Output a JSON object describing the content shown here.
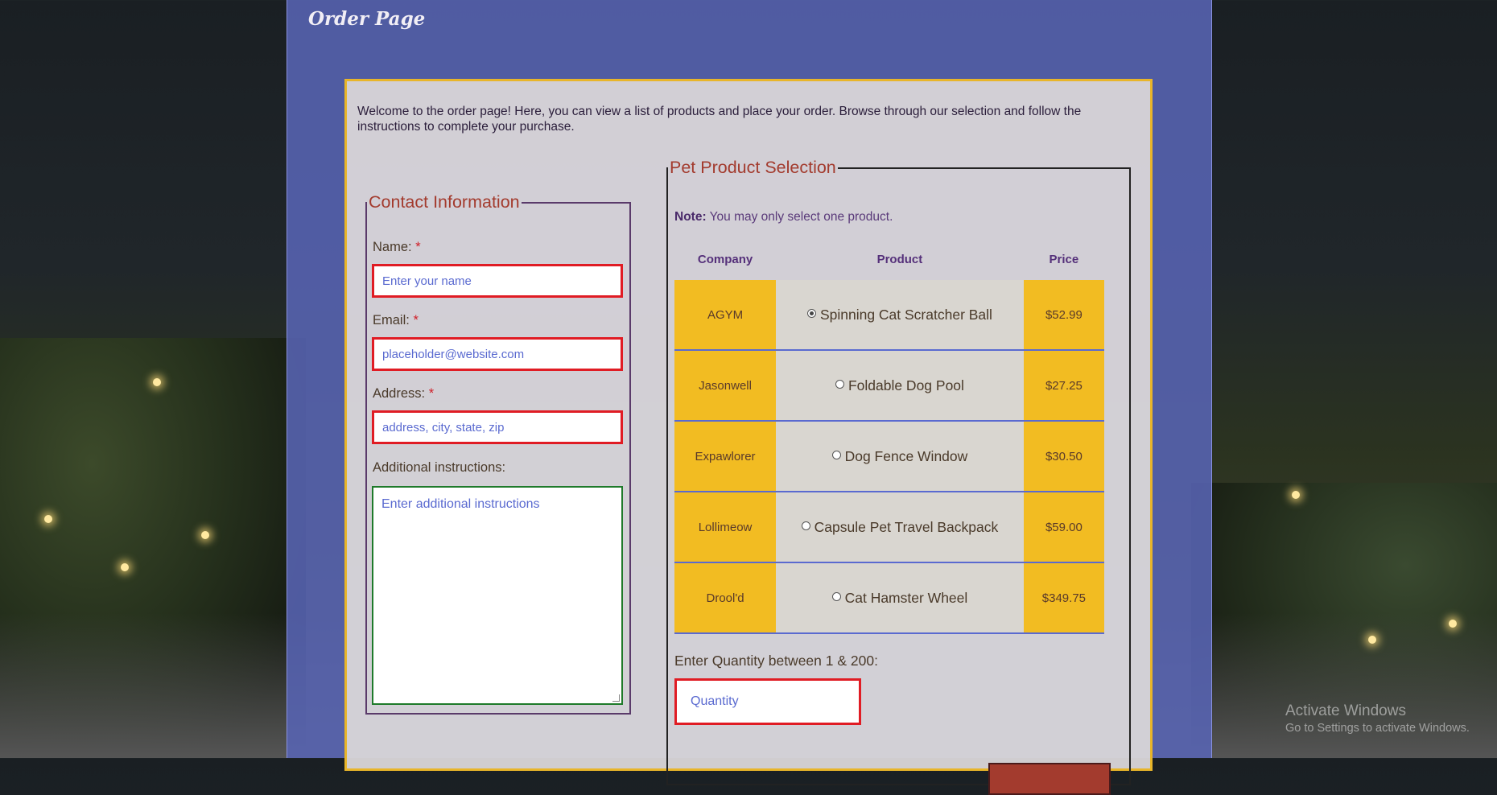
{
  "page": {
    "title": "Order Page"
  },
  "intro": "Welcome to the order page! Here, you can view a list of products and place your order. Browse through our selection and follow the instructions to complete your purchase.",
  "contact": {
    "legend": "Contact Information",
    "name_label": "Name:",
    "name_placeholder": "Enter your name",
    "email_label": "Email:",
    "email_placeholder": "placeholder@website.com",
    "address_label": "Address:",
    "address_placeholder": "address, city, state, zip",
    "instructions_label": "Additional instructions:",
    "instructions_placeholder": "Enter additional instructions",
    "required_marker": "*"
  },
  "products": {
    "legend": "Pet Product Selection",
    "note_bold": "Note:",
    "note_text": " You may only select one product.",
    "headers": [
      "Company",
      "Product",
      "Price"
    ],
    "rows": [
      {
        "company": "AGYM",
        "product": "Spinning Cat Scratcher Ball",
        "price": "$52.99",
        "selected": true
      },
      {
        "company": "Jasonwell",
        "product": "Foldable Dog Pool",
        "price": "$27.25",
        "selected": false
      },
      {
        "company": "Expawlorer",
        "product": "Dog Fence Window",
        "price": "$30.50",
        "selected": false
      },
      {
        "company": "Lollimeow",
        "product": "Capsule Pet Travel Backpack",
        "price": "$59.00",
        "selected": false
      },
      {
        "company": "Drool'd",
        "product": "Cat Hamster Wheel",
        "price": "$349.75",
        "selected": false
      }
    ],
    "quantity_label": "Enter Quantity between 1 & 200:",
    "quantity_placeholder": "Quantity"
  },
  "watermark": {
    "title": "Activate Windows",
    "subtitle": "Go to Settings to activate Windows."
  },
  "colors": {
    "panel": "#5864b4",
    "accent_gold": "#f2bc22",
    "legend_red": "#a33b2e",
    "error_border": "#e01c24",
    "valid_border": "#1e7a2a"
  }
}
